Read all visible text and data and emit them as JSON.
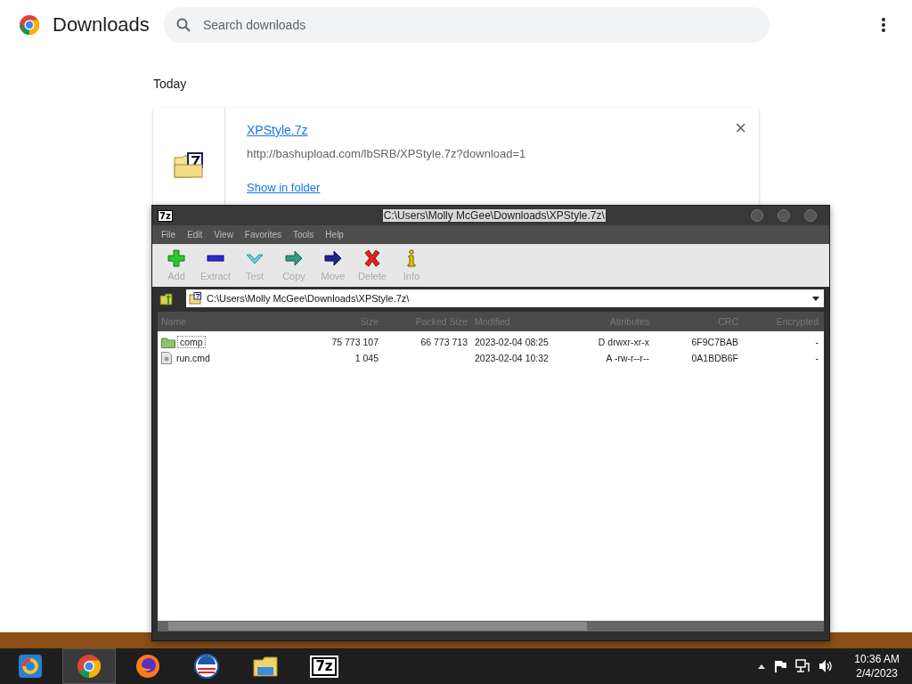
{
  "header": {
    "title": "Downloads",
    "search": {
      "placeholder": "Search downloads"
    }
  },
  "section": "Today",
  "download": {
    "file": "XPStyle.7z",
    "url": "http://bashupload.com/lbSRB/XPStyle.7z?download=1",
    "action": "Show in folder",
    "close": "×"
  },
  "archive_window": {
    "logo": "7z",
    "title": "C:\\Users\\Molly McGee\\Downloads\\XPStyle.7z\\",
    "menu": [
      "File",
      "Edit",
      "View",
      "Favorites",
      "Tools",
      "Help"
    ],
    "toolbar": [
      {
        "kind": "add",
        "label": "Add"
      },
      {
        "kind": "extract",
        "label": "Extract"
      },
      {
        "kind": "test",
        "label": "Test"
      },
      {
        "kind": "copy",
        "label": "Copy"
      },
      {
        "kind": "move",
        "label": "Move"
      },
      {
        "kind": "delete",
        "label": "Delete"
      },
      {
        "kind": "info",
        "label": "Info"
      }
    ],
    "address": "C:\\Users\\Molly McGee\\Downloads\\XPStyle.7z\\",
    "columns": [
      "Name",
      "Size",
      "Packed Size",
      "Modified",
      "Attributes",
      "CRC",
      "Encrypted"
    ],
    "rows": [
      {
        "kind": "folder",
        "selected": true,
        "cells": [
          "comp",
          "75 773 107",
          "66 773 713",
          "2023-02-04 08:25",
          "D drwxr-xr-x",
          "6F9C7BAB",
          "-"
        ]
      },
      {
        "kind": "file",
        "selected": false,
        "cells": [
          "run.cmd",
          "1 045",
          "",
          "2023-02-04 10:32",
          "A -rw-r--r--",
          "0A1BDB6F",
          "-"
        ]
      }
    ]
  },
  "taskbar": {
    "apps": [
      {
        "kind": "orb",
        "selected": false
      },
      {
        "kind": "chrome",
        "selected": true
      },
      {
        "kind": "firefox",
        "selected": false
      },
      {
        "kind": "logo",
        "selected": false
      },
      {
        "kind": "explorer",
        "selected": false
      },
      {
        "kind": "sevenzip",
        "label": "7z",
        "selected": false
      }
    ],
    "time": "10:36 AM",
    "date": "2/4/2023"
  }
}
